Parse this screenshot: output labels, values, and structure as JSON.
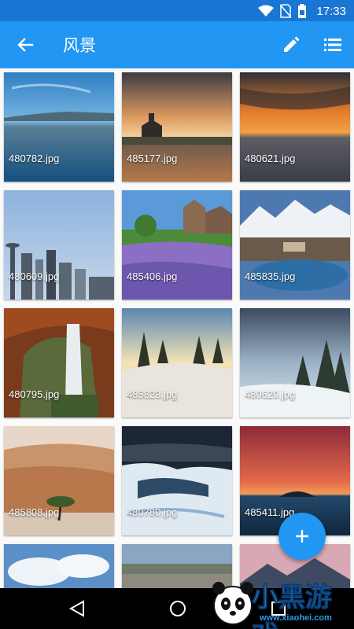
{
  "status_bar": {
    "time": "17:33",
    "icons": [
      "wifi-icon",
      "no-sim-icon",
      "battery-icon"
    ]
  },
  "app_bar": {
    "title": "风景",
    "back_icon": "back-arrow-icon",
    "edit_icon": "pencil-icon",
    "view_icon": "list-view-icon"
  },
  "colors": {
    "primary": "#2196f3",
    "primary_dark": "#1976d2",
    "nav": "#000000"
  },
  "grid": {
    "images": [
      {
        "name": "480782.jpg"
      },
      {
        "name": "485177.jpg"
      },
      {
        "name": "480621.jpg"
      },
      {
        "name": "480609.jpg"
      },
      {
        "name": "485406.jpg"
      },
      {
        "name": "485835.jpg"
      },
      {
        "name": "480795.jpg"
      },
      {
        "name": "485823.jpg"
      },
      {
        "name": "480620.jpg"
      },
      {
        "name": "485808.jpg"
      },
      {
        "name": "480780.jpg"
      },
      {
        "name": "485411.jpg"
      },
      {
        "name": ""
      },
      {
        "name": ""
      },
      {
        "name": ""
      }
    ]
  },
  "fab": {
    "icon": "plus-icon"
  },
  "nav_bar": {
    "icons": [
      "nav-back-icon",
      "nav-home-icon",
      "nav-recents-icon"
    ]
  },
  "watermark": {
    "text": "小黑游戏",
    "url": "www.xiaohei.com"
  }
}
